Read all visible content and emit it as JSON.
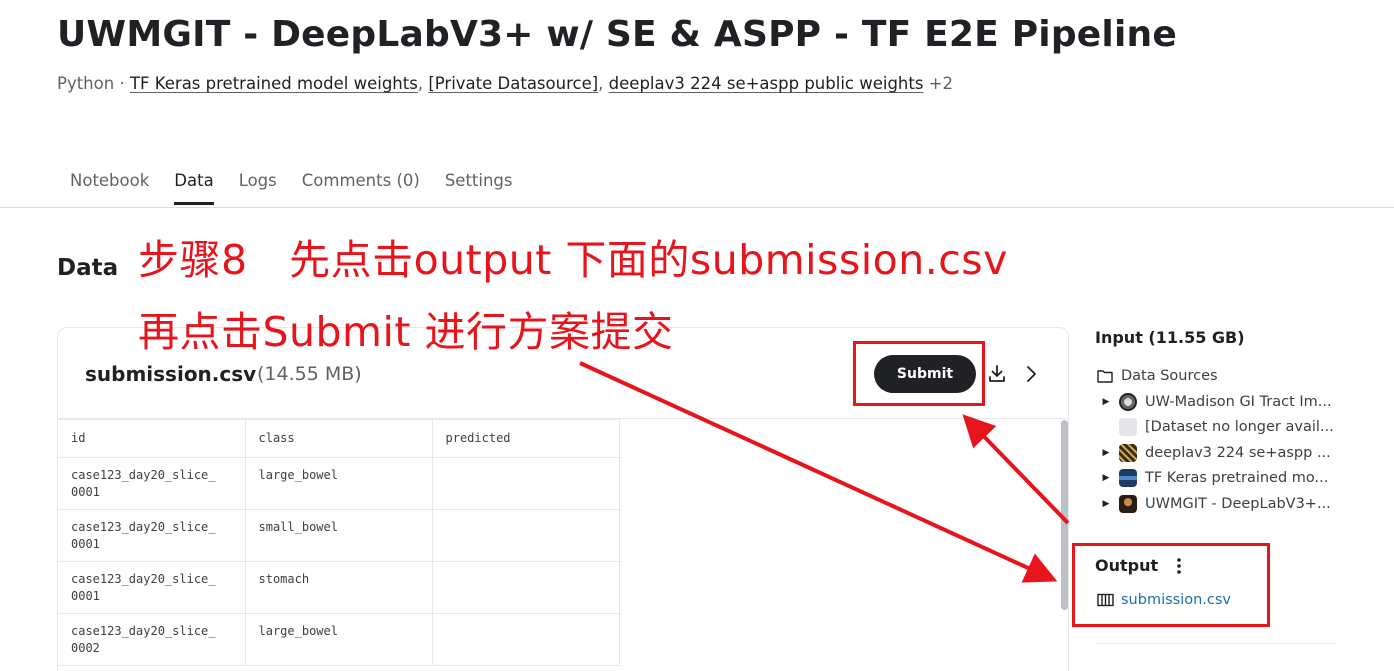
{
  "header": {
    "title": "UWMGIT - DeepLabV3+ w/ SE & ASPP - TF E2E Pipeline",
    "language": "Python",
    "separator": "·",
    "sources": [
      "TF Keras pretrained model weights",
      "[Private Datasource]",
      "deeplav3 224 se+aspp public weights"
    ],
    "more_sources": "+2"
  },
  "tabs": [
    "Notebook",
    "Data",
    "Logs",
    "Comments (0)",
    "Settings"
  ],
  "active_tab": "Data",
  "section_title": "Data",
  "file_card": {
    "name": "submission.csv",
    "size": "(14.55 MB)",
    "submit_label": "Submit",
    "columns": [
      "id",
      "class",
      "predicted"
    ],
    "rows": [
      [
        "case123_day20_slice_\n0001",
        "large_bowel",
        ""
      ],
      [
        "case123_day20_slice_\n0001",
        "small_bowel",
        ""
      ],
      [
        "case123_day20_slice_\n0001",
        "stomach",
        ""
      ],
      [
        "case123_day20_slice_\n0002",
        "large_bowel",
        ""
      ]
    ]
  },
  "sidebar": {
    "input_title": "Input (11.55 GB)",
    "data_sources_label": "Data Sources",
    "items": [
      {
        "label": "UW-Madison GI Tract Im...",
        "icon": "competition-icon",
        "expandable": true
      },
      {
        "label": "[Dataset no longer avail...",
        "icon": "placeholder-icon",
        "expandable": false
      },
      {
        "label": "deeplav3 224 se+aspp ...",
        "icon": "dataset-icon",
        "expandable": true
      },
      {
        "label": "TF Keras pretrained mo...",
        "icon": "dataset-icon",
        "expandable": true
      },
      {
        "label": "UWMGIT - DeepLabV3+...",
        "icon": "notebook-icon",
        "expandable": true
      }
    ],
    "output_title": "Output",
    "output_file": "submission.csv"
  },
  "annotation": {
    "line1": "步骤8　先点击output 下面的submission.csv",
    "line2": "再点击Submit 进行方案提交",
    "color": "#e8141c"
  }
}
